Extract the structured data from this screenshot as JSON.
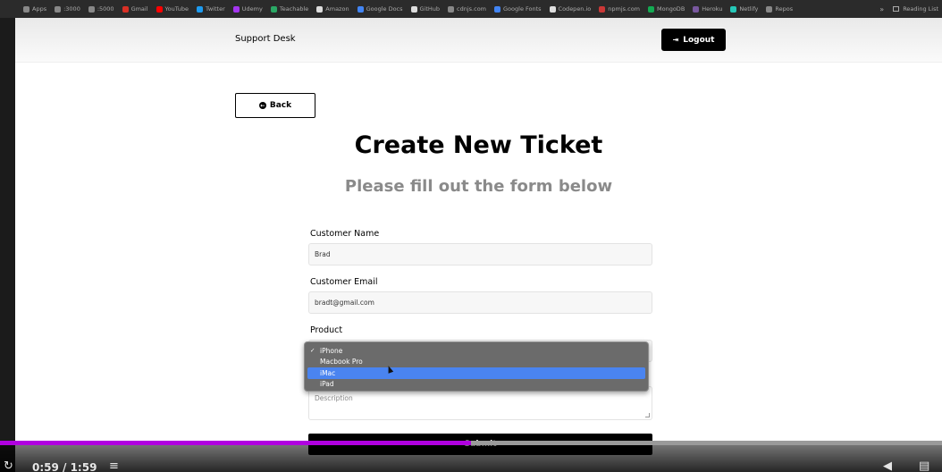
{
  "bookmarks": [
    {
      "label": "Apps",
      "icon": "apps-grid-icon",
      "color": "#888888"
    },
    {
      "label": ":3000",
      "icon": "localhost-icon",
      "color": "#888888"
    },
    {
      "label": ":5000",
      "icon": "globe-icon",
      "color": "#888888"
    },
    {
      "label": "Gmail",
      "icon": "gmail-icon",
      "color": "#d93025"
    },
    {
      "label": "YouTube",
      "icon": "youtube-icon",
      "color": "#ff0000"
    },
    {
      "label": "Twitter",
      "icon": "twitter-icon",
      "color": "#1d9bf0"
    },
    {
      "label": "Udemy",
      "icon": "udemy-icon",
      "color": "#a435f0"
    },
    {
      "label": "Teachable",
      "icon": "teachable-icon",
      "color": "#2aa865"
    },
    {
      "label": "Amazon",
      "icon": "amazon-icon",
      "color": "#dddddd"
    },
    {
      "label": "Google Docs",
      "icon": "docs-icon",
      "color": "#4285f4"
    },
    {
      "label": "GitHub",
      "icon": "github-icon",
      "color": "#dddddd"
    },
    {
      "label": "cdnjs.com",
      "icon": "code-icon",
      "color": "#888888"
    },
    {
      "label": "Google Fonts",
      "icon": "fonts-icon",
      "color": "#4285f4"
    },
    {
      "label": "Codepen.io",
      "icon": "codepen-icon",
      "color": "#dddddd"
    },
    {
      "label": "npmjs.com",
      "icon": "npm-icon",
      "color": "#cb3837"
    },
    {
      "label": "MongoDB",
      "icon": "mongodb-icon",
      "color": "#13aa52"
    },
    {
      "label": "Heroku",
      "icon": "heroku-icon",
      "color": "#79589f"
    },
    {
      "label": "Netlify",
      "icon": "netlify-icon",
      "color": "#25c7b7"
    },
    {
      "label": "Repos",
      "icon": "folder-icon",
      "color": "#888888"
    }
  ],
  "bookmarks_overflow": "»",
  "reading_list": "Reading List",
  "header": {
    "brand": "Support Desk",
    "logout": "Logout",
    "logout_icon": "⇥"
  },
  "back_button": {
    "label": "Back",
    "icon": "←"
  },
  "title": "Create New Ticket",
  "subtitle": "Please fill out the form below",
  "form": {
    "customer_name_label": "Customer Name",
    "customer_name_value": "Brad",
    "customer_email_label": "Customer Email",
    "customer_email_value": "bradt@gmail.com",
    "product_label": "Product",
    "product_options": [
      {
        "label": "iPhone",
        "checked": true,
        "highlighted": false
      },
      {
        "label": "Macbook Pro",
        "checked": false,
        "highlighted": false
      },
      {
        "label": "iMac",
        "checked": false,
        "highlighted": true
      },
      {
        "label": "iPad",
        "checked": false,
        "highlighted": false
      }
    ],
    "description_placeholder": "Description",
    "submit": "Submit"
  },
  "video": {
    "time": "0:59 / 1:59",
    "progress": 0.5,
    "progress_color": "#b000e0"
  }
}
